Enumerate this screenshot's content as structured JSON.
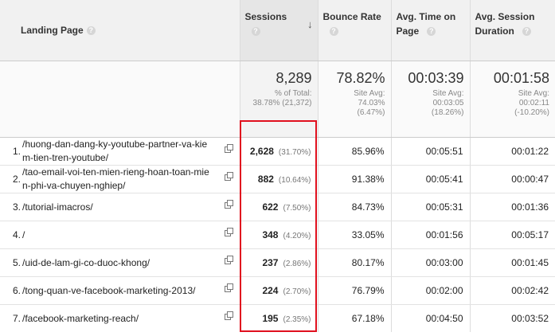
{
  "columns": {
    "landing_page": "Landing Page",
    "sessions": "Sessions",
    "bounce_rate": "Bounce Rate",
    "avg_time_line1": "Avg. Time on",
    "avg_time_line2": "Page",
    "avg_session_line1": "Avg. Session",
    "avg_session_line2": "Duration",
    "help_icon": "?",
    "sort_icon": "↓"
  },
  "summary": {
    "sessions": {
      "value": "8,289",
      "line1": "% of Total:",
      "line2": "38.78% (21,372)"
    },
    "bounce_rate": {
      "value": "78.82%",
      "line1": "Site Avg:",
      "line2": "74.03%",
      "line3": "(6.47%)"
    },
    "avg_time": {
      "value": "00:03:39",
      "line1": "Site Avg:",
      "line2": "00:03:05",
      "line3": "(18.26%)"
    },
    "avg_session": {
      "value": "00:01:58",
      "line1": "Site Avg:",
      "line2": "00:02:11",
      "line3": "(-10.20%)"
    }
  },
  "rows": [
    {
      "index": "1.",
      "page": "/huong-dan-dang-ky-youtube-partner-va-kiem-tien-tren-youtube/",
      "sessions": "2,628",
      "sessions_pct": "(31.70%)",
      "bounce_rate": "85.96%",
      "avg_time": "00:05:51",
      "avg_session": "00:01:22"
    },
    {
      "index": "2.",
      "page": "/tao-email-voi-ten-mien-rieng-hoan-toan-mien-phi-va-chuyen-nghiep/",
      "sessions": "882",
      "sessions_pct": "(10.64%)",
      "bounce_rate": "91.38%",
      "avg_time": "00:05:41",
      "avg_session": "00:00:47"
    },
    {
      "index": "3.",
      "page": "/tutorial-imacros/",
      "sessions": "622",
      "sessions_pct": "(7.50%)",
      "bounce_rate": "84.73%",
      "avg_time": "00:05:31",
      "avg_session": "00:01:36"
    },
    {
      "index": "4.",
      "page": "/",
      "sessions": "348",
      "sessions_pct": "(4.20%)",
      "bounce_rate": "33.05%",
      "avg_time": "00:01:56",
      "avg_session": "00:05:17"
    },
    {
      "index": "5.",
      "page": "/uid-de-lam-gi-co-duoc-khong/",
      "sessions": "237",
      "sessions_pct": "(2.86%)",
      "bounce_rate": "80.17%",
      "avg_time": "00:03:00",
      "avg_session": "00:01:45"
    },
    {
      "index": "6.",
      "page": "/tong-quan-ve-facebook-marketing-2013/",
      "sessions": "224",
      "sessions_pct": "(2.70%)",
      "bounce_rate": "76.79%",
      "avg_time": "00:02:00",
      "avg_session": "00:02:42"
    },
    {
      "index": "7.",
      "page": "/facebook-marketing-reach/",
      "sessions": "195",
      "sessions_pct": "(2.35%)",
      "bounce_rate": "67.18%",
      "avg_time": "00:04:50",
      "avg_session": "00:03:52"
    }
  ],
  "colors": {
    "highlight": "#e0101e",
    "header_bg": "#f1f1f1"
  }
}
